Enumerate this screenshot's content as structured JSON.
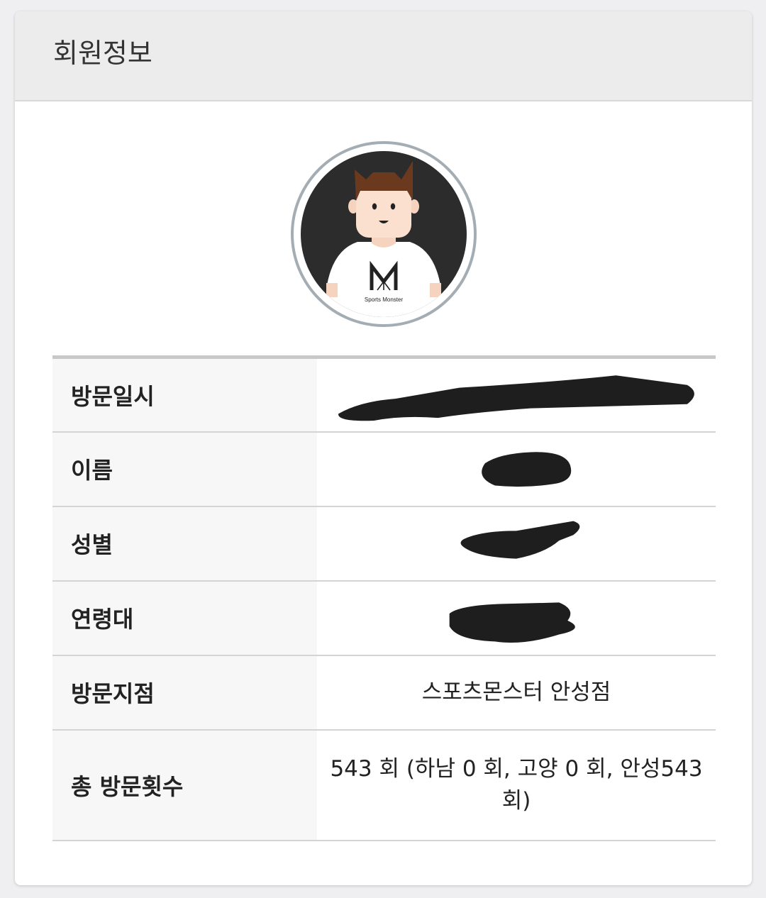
{
  "card": {
    "title": "회원정보"
  },
  "avatar": {
    "shirt_brand": "Sports Monster"
  },
  "member_info": {
    "rows": [
      {
        "label": "방문일시",
        "value": "",
        "redacted": true
      },
      {
        "label": "이름",
        "value": "",
        "redacted": true
      },
      {
        "label": "성별",
        "value": "",
        "redacted": true
      },
      {
        "label": "연령대",
        "value": "",
        "redacted": true
      },
      {
        "label": "방문지점",
        "value": "스포츠몬스터 안성점",
        "redacted": false
      },
      {
        "label": "총 방문횟수",
        "value": "543 회 (하남 0 회, 고양 0 회, 안성543 회)",
        "redacted": false
      }
    ]
  },
  "colors": {
    "header_bg": "#ececec",
    "label_bg": "#f7f7f7",
    "avatar_border": "#a4adb3",
    "avatar_bg": "#2c2c2c"
  }
}
